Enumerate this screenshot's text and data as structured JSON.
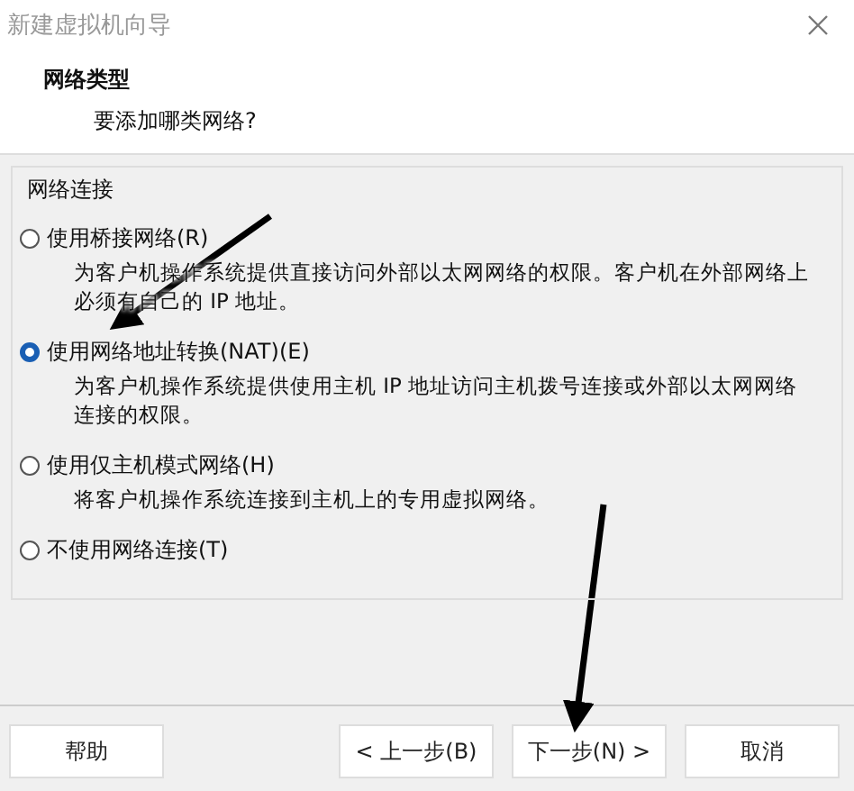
{
  "window": {
    "title": "新建虚拟机向导"
  },
  "header": {
    "title": "网络类型",
    "subtitle": "要添加哪类网络?"
  },
  "group": {
    "label": "网络连接",
    "options": [
      {
        "label": "使用桥接网络(R)",
        "description": "为客户机操作系统提供直接访问外部以太网网络的权限。客户机在外部网络上必须有自己的 IP 地址。",
        "selected": false
      },
      {
        "label": "使用网络地址转换(NAT)(E)",
        "description": "为客户机操作系统提供使用主机 IP 地址访问主机拨号连接或外部以太网网络连接的权限。",
        "selected": true
      },
      {
        "label": "使用仅主机模式网络(H)",
        "description": "将客户机操作系统连接到主机上的专用虚拟网络。",
        "selected": false
      },
      {
        "label": "不使用网络连接(T)",
        "selected": false
      }
    ]
  },
  "buttons": [
    {
      "label": "帮助"
    },
    {
      "label": "< 上一步(B)"
    },
    {
      "label": "下一步(N) >"
    },
    {
      "label": "取消"
    }
  ]
}
